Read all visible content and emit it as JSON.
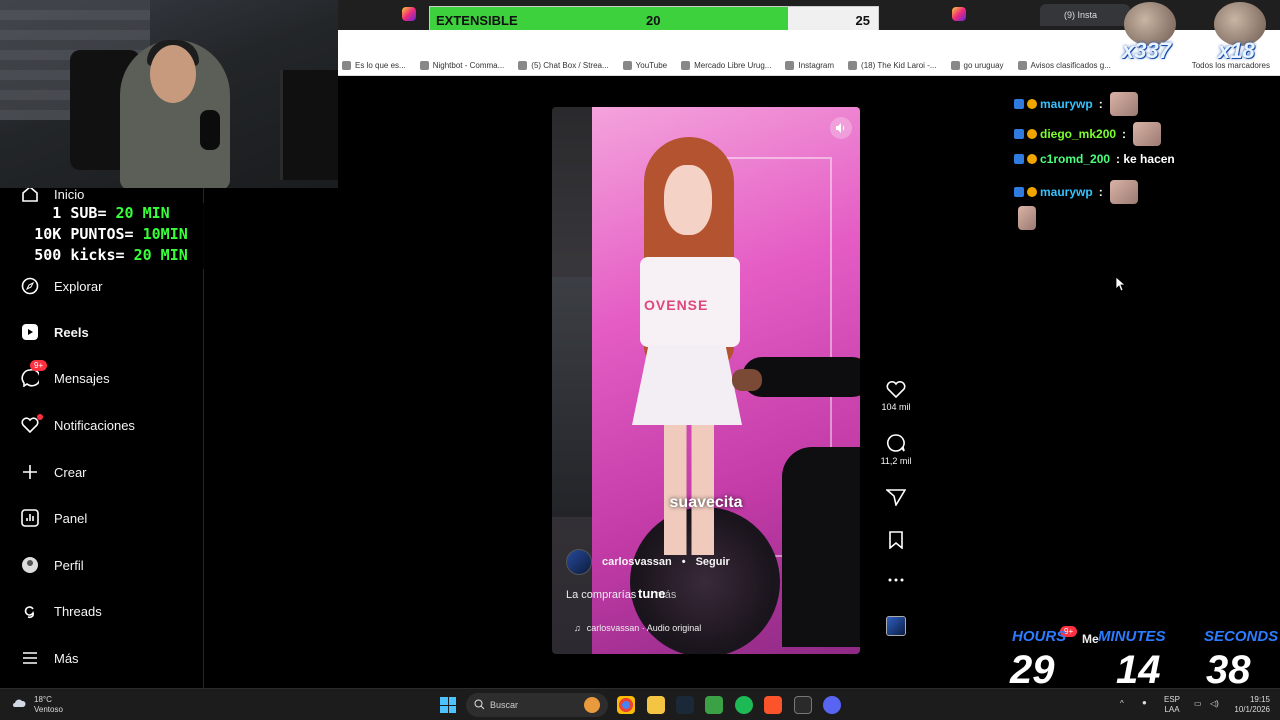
{
  "goal": {
    "label": "EXTENSIBLE",
    "current": "20",
    "target": "25",
    "progress": 0.8
  },
  "browser": {
    "active_tab": "(9) Insta",
    "bookmarks": [
      "Es lo que es...",
      "Nightbot - Comma...",
      "(5) Chat Box / Strea...",
      "YouTube",
      "Mercado Libre Urug...",
      "Instagram",
      "(18) The Kid Laroi -...",
      "go uruguay",
      "Avisos clasificados g..."
    ],
    "all_bookmarks": "Todos los marcadores"
  },
  "stream_overlay": {
    "line1_prefix": "1 SUB= ",
    "line1_value": "20 MIN",
    "line2_prefix": "10K PUNTOS= ",
    "line2_value": "10MIN",
    "line3_prefix": "500 kicks= ",
    "line3_value": "20 MIN"
  },
  "sidebar": {
    "items": [
      {
        "label": "Inicio",
        "icon": "home-icon"
      },
      {
        "label": "Explorar",
        "icon": "compass-icon"
      },
      {
        "label": "Reels",
        "icon": "reels-icon"
      },
      {
        "label": "Mensajes",
        "icon": "messenger-icon",
        "badge": "9+"
      },
      {
        "label": "Notificaciones",
        "icon": "heart-icon"
      },
      {
        "label": "Crear",
        "icon": "plus-icon"
      },
      {
        "label": "Panel",
        "icon": "chart-icon"
      },
      {
        "label": "Perfil",
        "icon": "profile-icon"
      },
      {
        "label": "Threads",
        "icon": "threads-icon"
      },
      {
        "label": "Más",
        "icon": "menu-icon"
      }
    ]
  },
  "reel": {
    "overlay_text": "suavecita",
    "shirt_text": "OVENSE",
    "author": "carlosvassan",
    "follow": "Seguir",
    "caption": "La comprarías",
    "caption_sub": "tune",
    "more": "... más",
    "audio": "carlosvassan · Audio original",
    "likes": "104 mil",
    "comments": "11,2 mil"
  },
  "chat": [
    {
      "user": "maurywp",
      "text": ":",
      "color": "#35c2ff"
    },
    {
      "user": "diego_mk200",
      "text": ":",
      "color": "#7bff2d"
    },
    {
      "user": "c1romd_200",
      "text": ": ke hacen",
      "color": "#4cff7c"
    },
    {
      "user": "maurywp",
      "text": ":",
      "color": "#35c2ff"
    }
  ],
  "counters": {
    "left": "x337",
    "right": "x18"
  },
  "timer": {
    "hours_label": "HOURS",
    "minutes_label": "MINUTES",
    "seconds_label": "SECONDS",
    "hours": "29",
    "minutes": "14",
    "seconds": "38",
    "messages": "Me",
    "badge": "9+"
  },
  "taskbar": {
    "temp": "18°C",
    "weather": "Ventoso",
    "search": "Buscar",
    "lang1": "ESP",
    "lang2": "LAA",
    "time": "19:15",
    "date": "10/1/2026"
  }
}
